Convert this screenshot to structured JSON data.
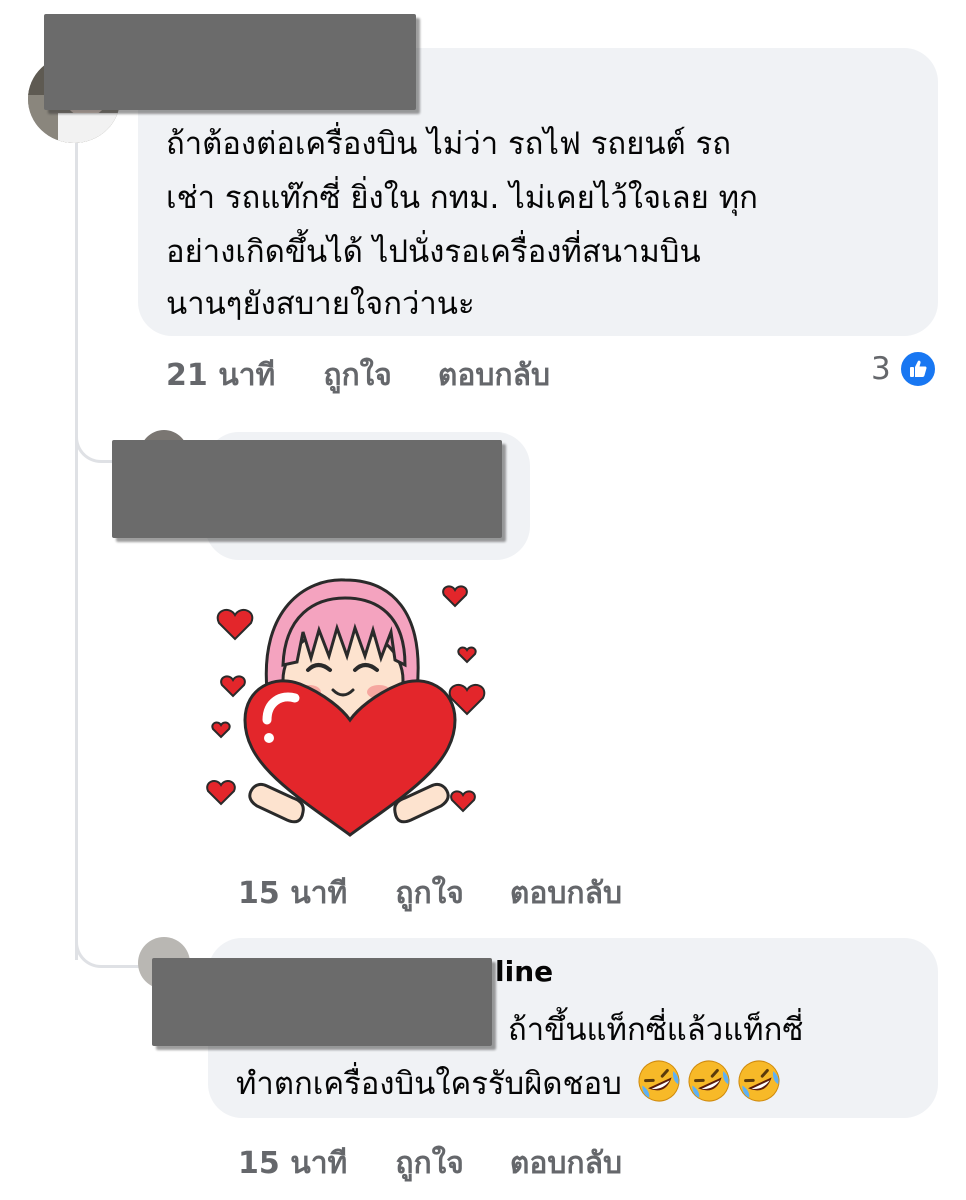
{
  "comments": [
    {
      "text_lines": [
        "ถ้าต้องต่อเครื่องบิน ไม่ว่า รถไฟ รถยนต์ รถ",
        "เช่า รถแท๊กซี่ ยิ่งใน กทม. ไม่เคยไว้ใจเลย ทุก",
        "อย่างเกิดขึ้นได้ ไปนั่งรอเครื่องที่สนามบิน",
        "นานๆยังสบายใจกว่านะ"
      ],
      "time": "21 นาที",
      "like_label": "ถูกใจ",
      "reply_label": "ตอบกลับ",
      "reaction_count": "3"
    },
    {
      "sticker": "heart-hug-girl-sticker",
      "time": "15 นาที",
      "like_label": "ถูกใจ",
      "reply_label": "ตอบกลับ"
    },
    {
      "name_partial": "line",
      "text_lines": [
        "ถ้าขึ้นแท็กซี่แล้วแท็กซี่",
        "ทำตกเครื่องบินใครรับผิดชอบ"
      ],
      "emoji_icon": "rolling-on-floor-laughing-emoji",
      "time": "15 นาที",
      "like_label": "ถูกใจ",
      "reply_label": "ตอบกลับ"
    }
  ],
  "colors": {
    "bubble": "#f0f2f5",
    "meta_text": "#65676b",
    "like_badge": "#1877f2",
    "redaction": "#6b6b6b",
    "heart_red": "#e3262b",
    "hair_pink": "#f4a3bf"
  }
}
